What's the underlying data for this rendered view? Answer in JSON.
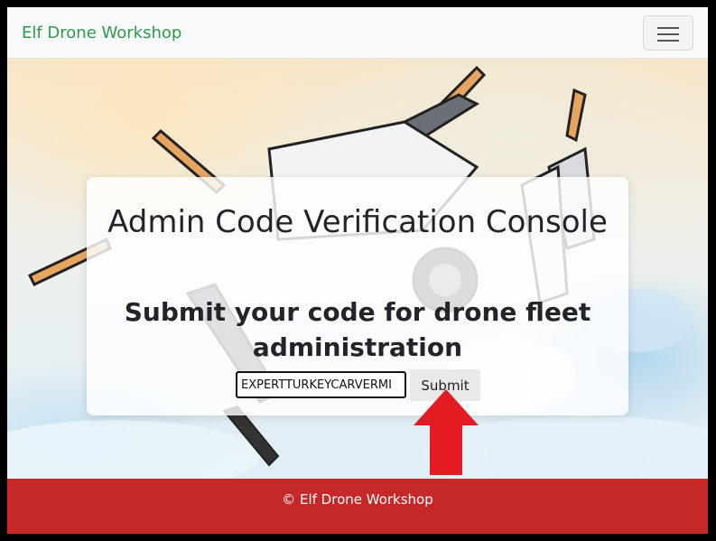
{
  "navbar": {
    "brand": "Elf Drone Workshop",
    "toggler_icon": "hamburger-menu-icon"
  },
  "main": {
    "title": "Admin Code Verification Console",
    "subtitle": "Submit your code for drone fleet administration",
    "code_input_value": "EXPERTTURKEYCARVERMI",
    "submit_label": "Submit"
  },
  "annotation": {
    "arrow_icon": "red-up-arrow-icon",
    "arrow_color": "#e31b23"
  },
  "footer": {
    "text": "© Elf Drone Workshop"
  },
  "colors": {
    "brand": "#2e9a4a",
    "footer_bg": "#c62828"
  }
}
